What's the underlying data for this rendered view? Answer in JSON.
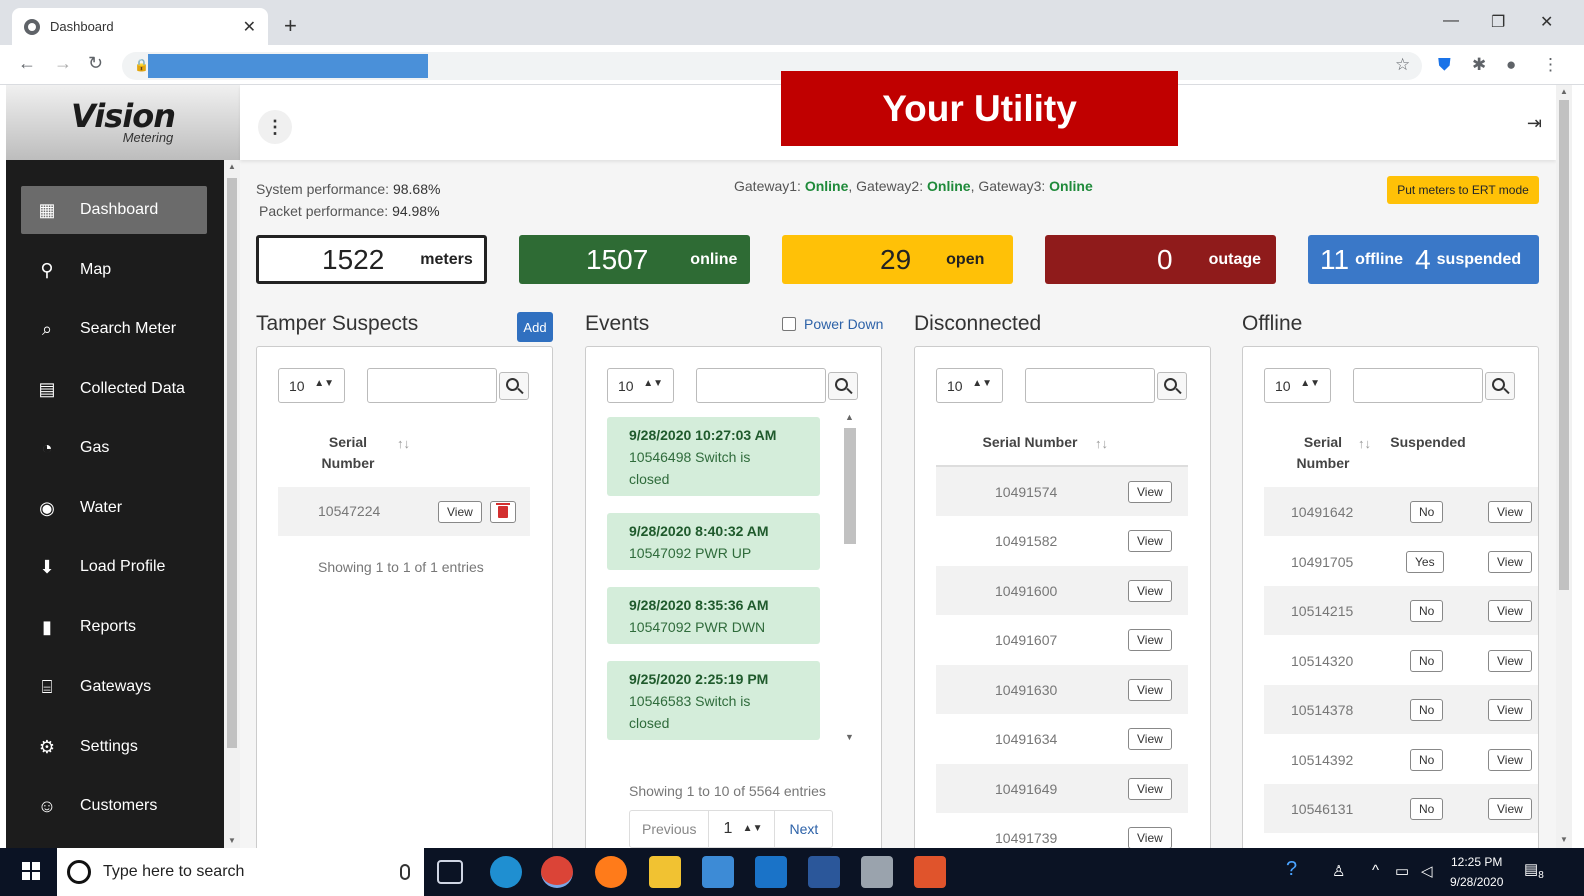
{
  "browser": {
    "tab_title": "Dashboard",
    "tab_close": "✕",
    "new_tab": "+"
  },
  "sidebar": {
    "logo_brand": "Vision",
    "logo_sub": "Metering",
    "items": [
      {
        "label": "Dashboard",
        "icon": "dashboard-icon"
      },
      {
        "label": "Map",
        "icon": "map-pin-icon"
      },
      {
        "label": "Search Meter",
        "icon": "search-icon"
      },
      {
        "label": "Collected Data",
        "icon": "table-icon"
      },
      {
        "label": "Gas",
        "icon": "gas-icon"
      },
      {
        "label": "Water",
        "icon": "water-drop-icon"
      },
      {
        "label": "Load Profile",
        "icon": "download-file-icon"
      },
      {
        "label": "Reports",
        "icon": "report-file-icon"
      },
      {
        "label": "Gateways",
        "icon": "router-icon"
      },
      {
        "label": "Settings",
        "icon": "gear-icon"
      },
      {
        "label": "Customers",
        "icon": "customers-icon"
      }
    ]
  },
  "header": {
    "banner": "Your Utility"
  },
  "performance": {
    "system_label": "System performance:",
    "system_value": "98.68%",
    "packet_label": "Packet performance:",
    "packet_value": "94.98%"
  },
  "gateways": {
    "g1_label": "Gateway1:",
    "g1_status": "Online",
    "g2_label": "Gateway2:",
    "g2_status": "Online",
    "g3_label": "Gateway3:",
    "g3_status": "Online",
    "sep": ","
  },
  "ert_button": "Put meters to ERT mode",
  "stats": {
    "meters": {
      "value": "1522",
      "label": "meters"
    },
    "online": {
      "value": "1507",
      "label": "online"
    },
    "open": {
      "value": "29",
      "label": "open"
    },
    "outage": {
      "value": "0",
      "label": "outage"
    },
    "offline": {
      "value": "11",
      "label": "offline"
    },
    "suspended": {
      "value": "4",
      "label": "suspended"
    }
  },
  "colors": {
    "online": "#2e6b34",
    "open": "#ffc107",
    "outage": "#8f1b1b",
    "offline": "#3a78c8",
    "banner": "#c00000"
  },
  "tamper": {
    "title": "Tamper Suspects",
    "add_label": "Add",
    "page_size": "10",
    "col_serial": "Serial Number",
    "rows": [
      {
        "serial": "10547224",
        "view": "View"
      }
    ],
    "footer": "Showing 1 to 1 of 1 entries"
  },
  "events": {
    "title": "Events",
    "power_down_label": "Power Down",
    "page_size": "10",
    "items": [
      {
        "datetime": "9/28/2020 10:27:03 AM",
        "text": "10546498 Switch is closed"
      },
      {
        "datetime": "9/28/2020 8:40:32 AM",
        "text": "10547092 PWR UP"
      },
      {
        "datetime": "9/28/2020 8:35:36 AM",
        "text": "10547092 PWR DWN"
      },
      {
        "datetime": "9/25/2020 2:25:19 PM",
        "text": "10546583 Switch is closed"
      }
    ],
    "footer": "Showing 1 to 10 of 5564 entries",
    "prev": "Previous",
    "page": "1",
    "next": "Next"
  },
  "disconnected": {
    "title": "Disconnected",
    "page_size": "10",
    "col_serial": "Serial Number",
    "view_label": "View",
    "rows": [
      "10491574",
      "10491582",
      "10491600",
      "10491607",
      "10491630",
      "10491634",
      "10491649",
      "10491739"
    ]
  },
  "offline": {
    "title": "Offline",
    "page_size": "10",
    "col_serial": "Serial Number",
    "col_suspended": "Suspended",
    "view_label": "View",
    "rows": [
      {
        "serial": "10491642",
        "suspended": "No"
      },
      {
        "serial": "10491705",
        "suspended": "Yes"
      },
      {
        "serial": "10514215",
        "suspended": "No"
      },
      {
        "serial": "10514320",
        "suspended": "No"
      },
      {
        "serial": "10514378",
        "suspended": "No"
      },
      {
        "serial": "10514392",
        "suspended": "No"
      },
      {
        "serial": "10546131",
        "suspended": "No"
      }
    ]
  },
  "taskbar": {
    "search_placeholder": "Type here to search",
    "time": "12:25 PM",
    "date": "9/28/2020",
    "notif_count": "8"
  }
}
